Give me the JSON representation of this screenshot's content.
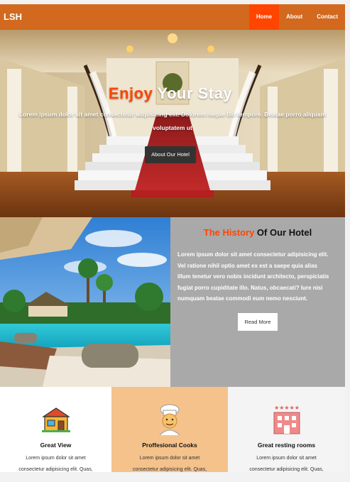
{
  "nav": {
    "brand": "LSH",
    "links": [
      {
        "label": "Home",
        "active": true
      },
      {
        "label": "About",
        "active": false
      },
      {
        "label": "Contact",
        "active": false
      }
    ],
    "bg_color": "#d2691e",
    "active_color": "#ff4500"
  },
  "hero": {
    "title_accent": "Enjoy",
    "title_rest": "Your Stay",
    "text_line1": "Lorem ipsum dolor sit amet consectetur adipisicing elit. Dolorem neque illo tempore. Beatae porro aliquam",
    "text_line2": "voluptatem ut",
    "button": "About Our Hotel"
  },
  "history": {
    "title_accent": "The History",
    "title_rest": "Of Our Hotel",
    "lines": [
      "Lorem ipsum dolor sit amet consectetur adipisicing elit.",
      "Vel ratione nihil optio amet ex est a saepe quia alias",
      "illum tenetur vero nobis incidunt architecto, perspiciatis",
      "fugiat porro cupiditate illo. Natus, obcaecati? Iure nisi",
      "numquam beatae commodi eum nemo nesciunt."
    ],
    "button": "Read More"
  },
  "features": [
    {
      "icon": "house-icon",
      "title": "Great View",
      "line1": "Lorem ipsum dolor sit amet",
      "line2": "consectetur adipisicing elit. Quas,"
    },
    {
      "icon": "cook-icon",
      "title": "Proffesional Cooks",
      "line1": "Lorem ipsum dolor sit amet",
      "line2": "consectetur adipisicing elit. Quas,"
    },
    {
      "icon": "hotel-icon",
      "title": "Great resting rooms",
      "line1": "Lorem ipsum dolor sit amet",
      "line2": "consectetur adipisicing elit. Quas,"
    }
  ]
}
